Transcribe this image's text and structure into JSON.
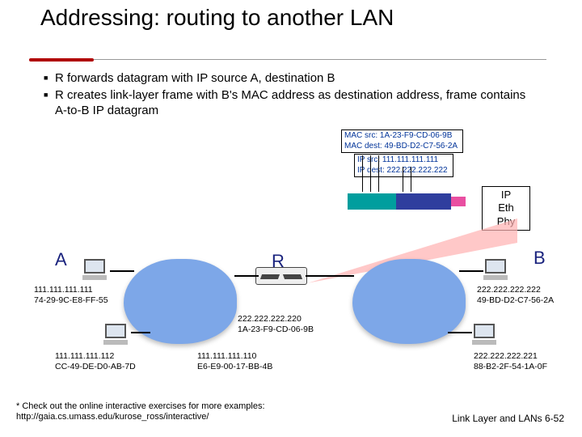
{
  "title": "Addressing: routing to another LAN",
  "bullets": [
    "R forwards datagram with IP source A, destination B",
    "R creates link-layer frame with B's MAC address as destination address, frame contains A-to-B IP datagram"
  ],
  "headers": {
    "mac_src": "MAC src: 1A-23-F9-CD-06-9B",
    "mac_dest": "MAC dest: 49-BD-D2-C7-56-2A",
    "ip_src": "IP src: 111.111.111.111",
    "ip_dest": "IP dest: 222.222.222.222"
  },
  "stack": {
    "l1": "IP",
    "l2": "Eth",
    "l3": "Phy"
  },
  "labels": {
    "A": "A",
    "R": "R",
    "B": "B"
  },
  "addr": {
    "A1": {
      "ip": "111.111.111.111",
      "mac": "74-29-9C-E8-FF-55"
    },
    "A2": {
      "ip": "111.111.111.112",
      "mac": "CC-49-DE-D0-AB-7D"
    },
    "Rleft": {
      "ip": "111.111.111.110",
      "mac": "E6-E9-00-17-BB-4B"
    },
    "Rright": {
      "ip": "222.222.222.220",
      "mac": "1A-23-F9-CD-06-9B"
    },
    "B1": {
      "ip": "222.222.222.222",
      "mac": "49-BD-D2-C7-56-2A"
    },
    "B2": {
      "ip": "222.222.222.221",
      "mac": "88-B2-2F-54-1A-0F"
    }
  },
  "footnote": "* Check out the online interactive exercises for more examples: http://gaia.cs.umass.edu/kurose_ross/interactive/",
  "slide_ref": "Link Layer and LANs  6-52"
}
